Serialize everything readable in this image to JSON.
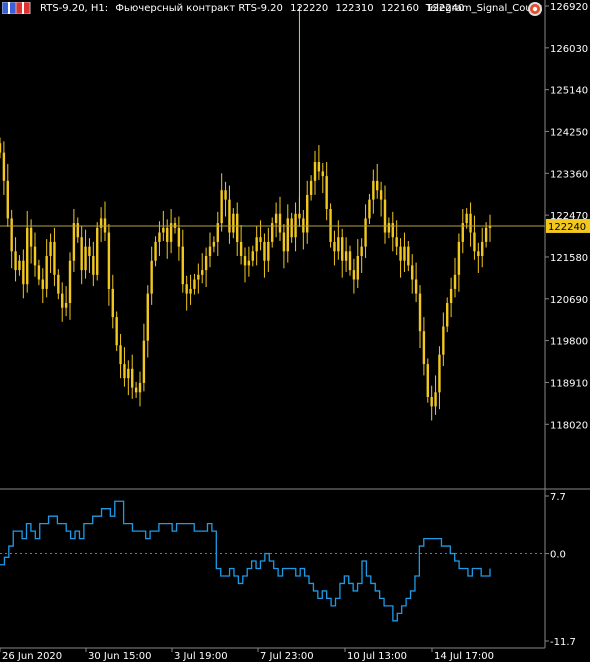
{
  "header": {
    "symbol_tf": "RTS-9.20, H1:",
    "description": "Фьючерсный контракт RTS-9.20",
    "o": "122220",
    "h": "122310",
    "l": "122160",
    "c": "122240"
  },
  "indicator": {
    "name": "Telegram_Signal_Count"
  },
  "colors": {
    "background": "#000000",
    "candles": "#f2c81e",
    "price_line": "#b9a040",
    "indicator_line": "#1e9be6",
    "axis_text": "#ffffff",
    "grid_text": "#ffffff",
    "price_label_bg": "#f2c81e"
  },
  "icons": [
    "flag-icon",
    "gear-icon"
  ],
  "chart_data": [
    {
      "type": "candlestick",
      "ylim": [
        117600,
        126920
      ],
      "y_ticks": [
        "126920",
        "126030",
        "125140",
        "124250",
        "123360",
        "122470",
        "121580",
        "120690",
        "119800",
        "118910",
        "118020"
      ],
      "current_price": "122240",
      "x_labels": [
        "26 Jun 2020",
        "30 Jun 15:00",
        "3 Jul 19:00",
        "7 Jul 23:00",
        "10 Jul 13:00",
        "14 Jul 17:00"
      ],
      "close_series": [
        123800,
        123200,
        122400,
        121700,
        121300,
        121500,
        121000,
        122200,
        121800,
        121400,
        121100,
        120900,
        121600,
        121900,
        121200,
        120800,
        120500,
        120600,
        121500,
        122300,
        122000,
        121300,
        121800,
        121600,
        121200,
        122200,
        122400,
        122100,
        120900,
        120300,
        119700,
        119300,
        119000,
        119200,
        118800,
        118700,
        118900,
        119800,
        120800,
        121500,
        121900,
        122100,
        122200,
        121900,
        122300,
        122200,
        121800,
        121000,
        120800,
        120900,
        121100,
        121200,
        121300,
        121600,
        121800,
        121900,
        122300,
        123000,
        122800,
        122100,
        122500,
        121900,
        121600,
        121400,
        121500,
        121700,
        122000,
        121900,
        121500,
        121900,
        122300,
        122500,
        122100,
        121700,
        122400,
        122000,
        122500,
        122400,
        122100,
        122900,
        123200,
        123600,
        123400,
        123300,
        122600,
        121900,
        121700,
        122000,
        121500,
        121700,
        121300,
        121100,
        121600,
        121800,
        122400,
        122800,
        123200,
        123000,
        122800,
        122100,
        122300,
        122000,
        121800,
        121500,
        121800,
        121400,
        121100,
        120800,
        120000,
        119300,
        118600,
        118400,
        118700,
        119500,
        120100,
        120600,
        120900,
        121200,
        121900,
        122300,
        122500,
        122100,
        121700,
        121600,
        121900,
        122200,
        122240
      ],
      "spike": {
        "x_index": 77,
        "high": 126920
      }
    },
    {
      "type": "line",
      "ylim": [
        -11.7,
        7.7
      ],
      "y_ticks": [
        "7.7",
        "0.0",
        "-11.7"
      ],
      "zero_line": 0.0,
      "values": [
        -1.5,
        -0.5,
        1,
        3,
        3,
        2,
        4,
        3,
        2,
        4,
        4,
        5,
        5,
        4,
        4,
        3,
        2,
        3,
        2,
        4,
        4,
        5,
        5,
        6,
        6,
        5,
        7,
        7,
        4,
        4,
        3,
        3,
        3,
        2,
        3,
        3,
        4,
        4,
        4,
        3,
        4,
        4,
        4,
        4,
        3,
        3,
        3,
        4,
        3,
        -2,
        -3,
        -3,
        -2,
        -3,
        -4,
        -3,
        -2,
        -1,
        -2,
        -1,
        0,
        -1,
        -2,
        -3,
        -2,
        -2,
        -2,
        -3,
        -2,
        -3,
        -4,
        -5,
        -6,
        -5,
        -6,
        -7,
        -6,
        -4,
        -3,
        -4,
        -5,
        -4,
        -1,
        -3,
        -4,
        -5,
        -6,
        -7,
        -7,
        -9,
        -8,
        -7,
        -6,
        -5,
        -3,
        1,
        2,
        2,
        2,
        2,
        1,
        1,
        0,
        -1,
        -2,
        -2,
        -3,
        -2,
        -2,
        -3,
        -3,
        -2
      ],
      "color": "#1e9be6"
    }
  ]
}
